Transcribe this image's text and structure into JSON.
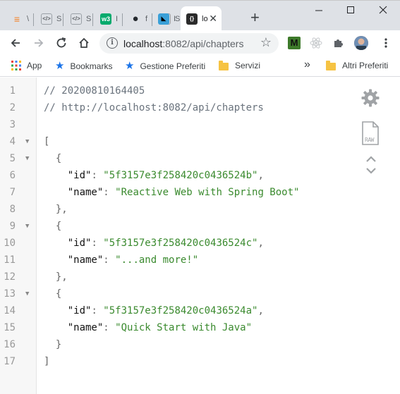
{
  "browser": {
    "tabs": [
      {
        "favicon": "stackoverflow-icon",
        "title": "\\",
        "color": "#f48024"
      },
      {
        "favicon": "code-icon",
        "title": "S",
        "color": "#5f6368"
      },
      {
        "favicon": "code-icon",
        "title": "S",
        "color": "#5f6368"
      },
      {
        "favicon": "w3schools-icon",
        "title": "I",
        "color": "#04aa6d"
      },
      {
        "favicon": "github-icon",
        "title": "f",
        "color": "#24292e"
      },
      {
        "favicon": "code-icon",
        "title": "S",
        "color": "#5f6368"
      },
      {
        "favicon": "dolphin-icon",
        "title": "I",
        "color": "#1da1f2"
      }
    ],
    "active_tab": {
      "title": "lo",
      "favicon": "json-viewer-icon"
    },
    "new_tab_label": "+",
    "url_host": "localhost",
    "url_rest": ":8082/api/chapters",
    "bookmarks": [
      {
        "icon": "apps-icon",
        "label": "App"
      },
      {
        "icon": "bookmark-star-icon",
        "label": "Bookmarks"
      },
      {
        "icon": "bookmark-star-icon",
        "label": "Gestione Preferiti"
      },
      {
        "icon": "folder-icon",
        "label": "Servizi"
      }
    ],
    "overflow_label": "»",
    "other_bookmarks": {
      "icon": "folder-icon",
      "label": "Altri Preferiti"
    },
    "colors": {
      "tabstrip": "#dee1e6",
      "accent": "#1a73e8"
    }
  },
  "viewer": {
    "lines": [
      {
        "n": "1",
        "fold": "",
        "tokens": [
          {
            "t": "// 20200810164405",
            "c": "comment"
          }
        ]
      },
      {
        "n": "2",
        "fold": "",
        "tokens": [
          {
            "t": "// http://localhost:8082/api/chapters",
            "c": "comment"
          }
        ]
      },
      {
        "n": "3",
        "fold": "",
        "tokens": []
      },
      {
        "n": "4",
        "fold": "▼",
        "tokens": [
          {
            "t": "[",
            "c": "punc"
          }
        ]
      },
      {
        "n": "5",
        "fold": "▼",
        "tokens": [
          {
            "t": "  {",
            "c": "punc"
          }
        ]
      },
      {
        "n": "6",
        "fold": "",
        "tokens": [
          {
            "t": "    ",
            "c": "punc"
          },
          {
            "t": "\"id\"",
            "c": "key"
          },
          {
            "t": ": ",
            "c": "punc"
          },
          {
            "t": "\"5f3157e3f258420c0436524b\"",
            "c": "str"
          },
          {
            "t": ",",
            "c": "punc"
          }
        ]
      },
      {
        "n": "7",
        "fold": "",
        "tokens": [
          {
            "t": "    ",
            "c": "punc"
          },
          {
            "t": "\"name\"",
            "c": "key"
          },
          {
            "t": ": ",
            "c": "punc"
          },
          {
            "t": "\"Reactive Web with Spring Boot\"",
            "c": "str"
          }
        ]
      },
      {
        "n": "8",
        "fold": "",
        "tokens": [
          {
            "t": "  },",
            "c": "punc"
          }
        ]
      },
      {
        "n": "9",
        "fold": "▼",
        "tokens": [
          {
            "t": "  {",
            "c": "punc"
          }
        ]
      },
      {
        "n": "10",
        "fold": "",
        "tokens": [
          {
            "t": "    ",
            "c": "punc"
          },
          {
            "t": "\"id\"",
            "c": "key"
          },
          {
            "t": ": ",
            "c": "punc"
          },
          {
            "t": "\"5f3157e3f258420c0436524c\"",
            "c": "str"
          },
          {
            "t": ",",
            "c": "punc"
          }
        ]
      },
      {
        "n": "11",
        "fold": "",
        "tokens": [
          {
            "t": "    ",
            "c": "punc"
          },
          {
            "t": "\"name\"",
            "c": "key"
          },
          {
            "t": ": ",
            "c": "punc"
          },
          {
            "t": "\"...and more!\"",
            "c": "str"
          }
        ]
      },
      {
        "n": "12",
        "fold": "",
        "tokens": [
          {
            "t": "  },",
            "c": "punc"
          }
        ]
      },
      {
        "n": "13",
        "fold": "▼",
        "tokens": [
          {
            "t": "  {",
            "c": "punc"
          }
        ]
      },
      {
        "n": "14",
        "fold": "",
        "tokens": [
          {
            "t": "    ",
            "c": "punc"
          },
          {
            "t": "\"id\"",
            "c": "key"
          },
          {
            "t": ": ",
            "c": "punc"
          },
          {
            "t": "\"5f3157e3f258420c0436524a\"",
            "c": "str"
          },
          {
            "t": ",",
            "c": "punc"
          }
        ]
      },
      {
        "n": "15",
        "fold": "",
        "tokens": [
          {
            "t": "    ",
            "c": "punc"
          },
          {
            "t": "\"name\"",
            "c": "key"
          },
          {
            "t": ": ",
            "c": "punc"
          },
          {
            "t": "\"Quick Start with Java\"",
            "c": "str"
          }
        ]
      },
      {
        "n": "16",
        "fold": "",
        "tokens": [
          {
            "t": "  }",
            "c": "punc"
          }
        ]
      },
      {
        "n": "17",
        "fold": "",
        "tokens": [
          {
            "t": "]",
            "c": "punc"
          }
        ]
      }
    ],
    "tools": {
      "settings_icon": "gear-icon",
      "raw_icon": "raw-file-icon",
      "raw_label": "RAW",
      "toggle_icon": "collapse-expand-icon"
    }
  }
}
